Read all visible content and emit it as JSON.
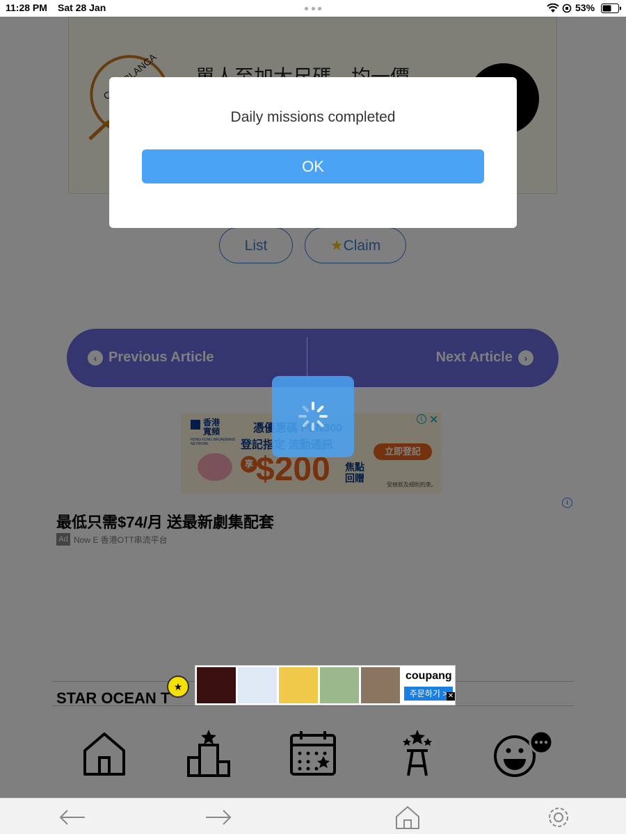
{
  "status_bar": {
    "time": "11:28 PM",
    "date": "Sat 28 Jan",
    "battery_percent": "53%",
    "battery_level": 0.53
  },
  "top_ad": {
    "brand": "CASABLANCA",
    "headline": "單人至加大尺碼，均一價"
  },
  "buttons": {
    "list_label": "List",
    "claim_label": "Claim"
  },
  "article_nav": {
    "previous_label": "Previous Article",
    "next_label": "Next Article"
  },
  "mid_ad": {
    "logo_cn": "香港寬頻",
    "logo_en": "HONG KONG BROADBAND NETWORK",
    "line1": "憑優惠碼 FUN300",
    "line2": "登記指定 流動通訊",
    "cta": "立即登記",
    "prefix": "享",
    "amount": "$200",
    "suffix_line1": "焦點",
    "suffix_line2": "回贈",
    "terms": "受條款及細則約束。"
  },
  "sponsored": {
    "title": "最低只需$74/月 送最新劇集配套",
    "badge": "Ad",
    "advertiser": "Now E 香港OTT串流平台"
  },
  "section": {
    "title": "STAR OCEAN T"
  },
  "bottom_ad": {
    "brand": "coupang",
    "cta": "주문하기 >"
  },
  "dialog": {
    "message": "Daily missions completed",
    "ok_label": "OK"
  },
  "colors": {
    "accent_blue": "#4aa3f5",
    "nav_purple": "#6a6ae0",
    "claim_star": "#f5c518"
  }
}
